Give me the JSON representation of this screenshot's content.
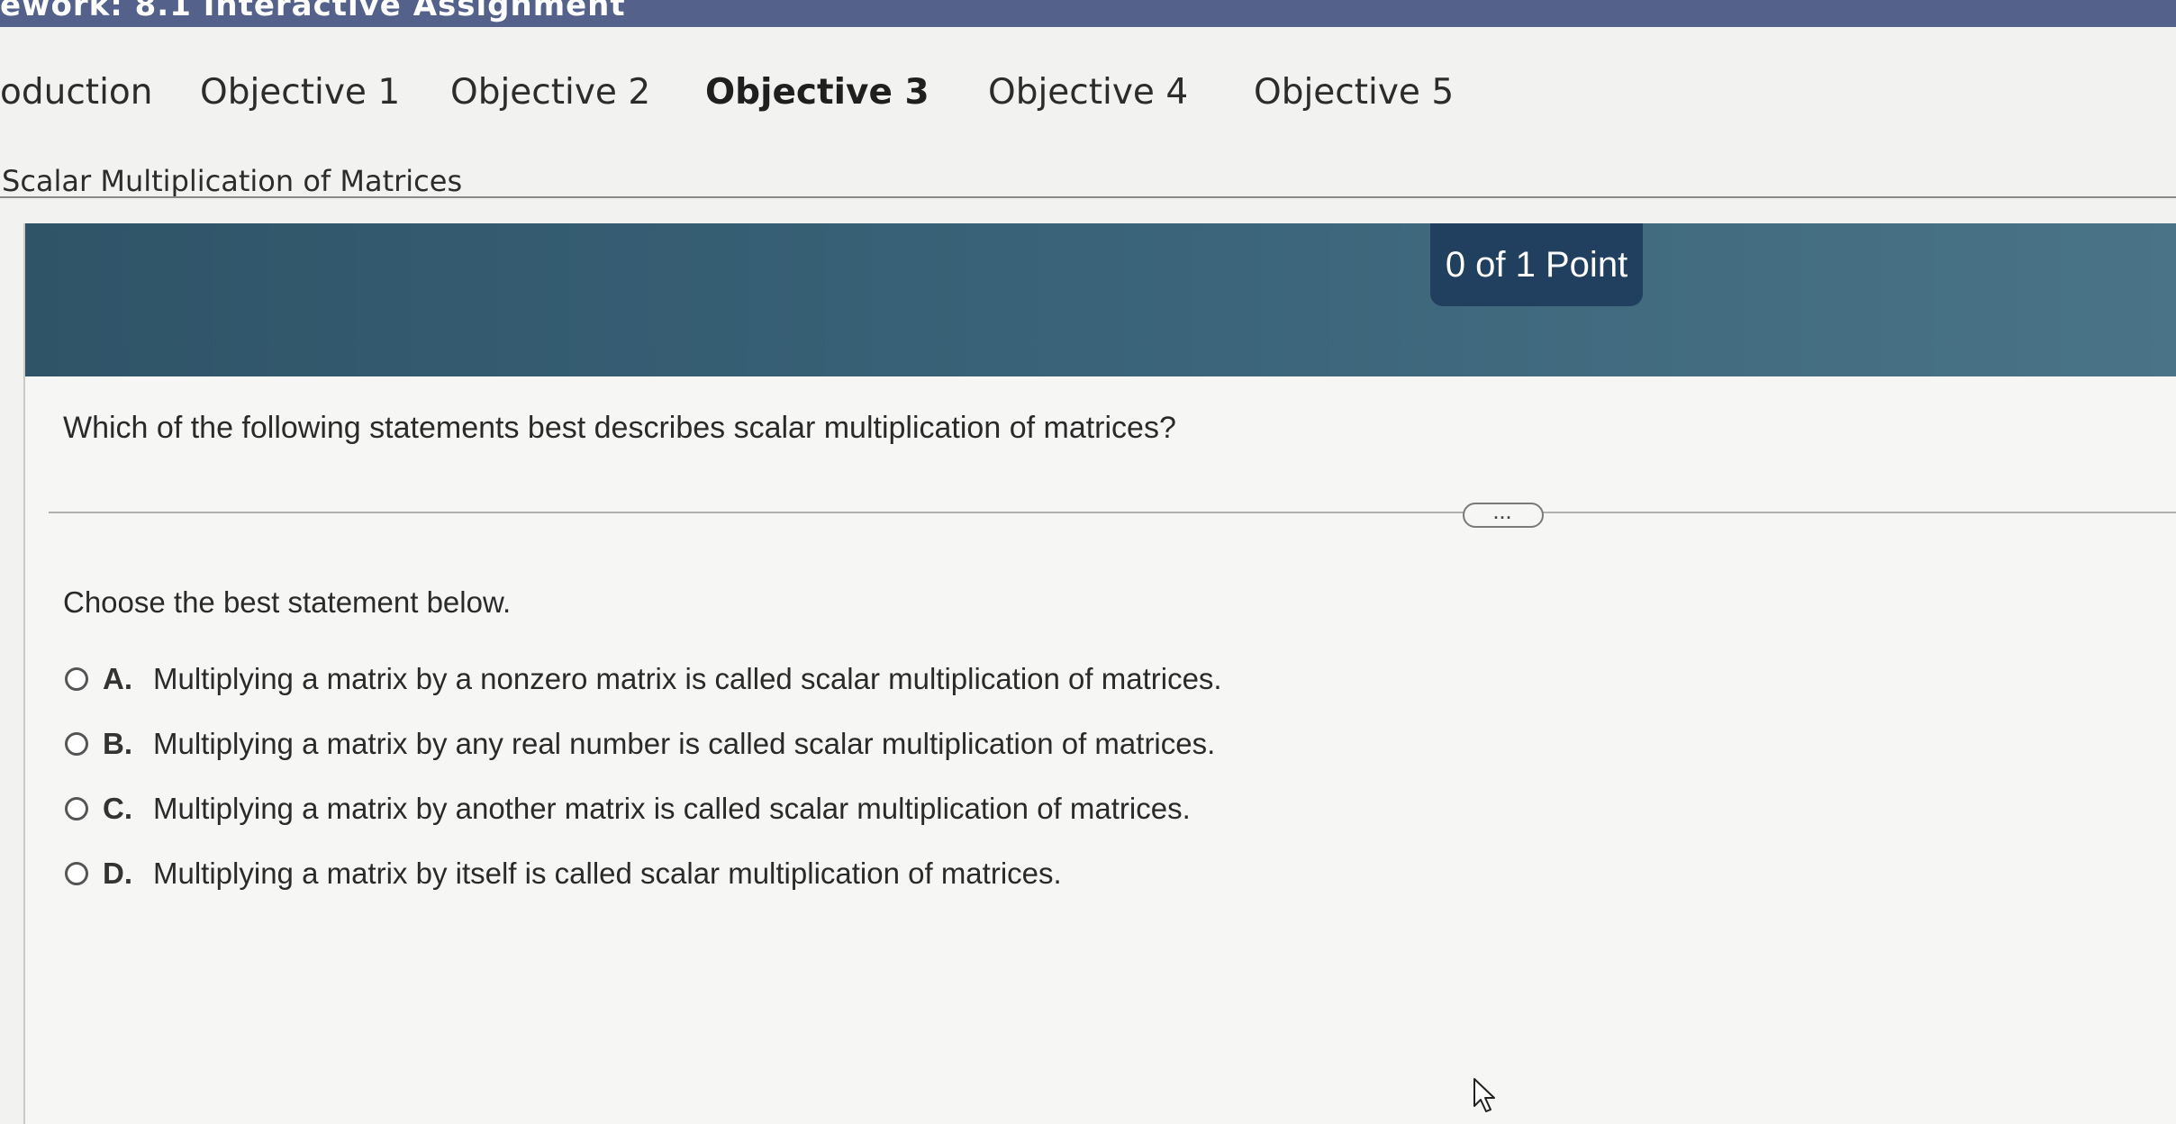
{
  "window": {
    "title": "ework: 8.1 Interactive Assignment"
  },
  "tabs": [
    {
      "label": "oduction",
      "active": false
    },
    {
      "label": "Objective 1",
      "active": false
    },
    {
      "label": "Objective 2",
      "active": false
    },
    {
      "label": "Objective 3",
      "active": true
    },
    {
      "label": "Objective 4",
      "active": false
    },
    {
      "label": "Objective 5",
      "active": false
    }
  ],
  "section": {
    "title": "Scalar Multiplication of Matrices"
  },
  "score": {
    "label": "0 of 1 Point"
  },
  "question": {
    "text": "Which of the following statements best describes scalar multiplication of matrices?",
    "more_label": "...",
    "prompt": "Choose the best statement below."
  },
  "options": [
    {
      "letter": "A.",
      "text": "Multiplying a matrix by a nonzero matrix is called scalar multiplication of matrices."
    },
    {
      "letter": "B.",
      "text": "Multiplying a matrix by any real number is called scalar multiplication of matrices."
    },
    {
      "letter": "C.",
      "text": "Multiplying a matrix by another matrix is called scalar multiplication of matrices."
    },
    {
      "letter": "D.",
      "text": "Multiplying a matrix by itself is called scalar multiplication of matrices."
    }
  ],
  "icons": {
    "radio": "radio-unselected-icon",
    "cursor": "mouse-pointer-icon"
  },
  "colors": {
    "banner": "#3a6379",
    "badge": "#213f5e",
    "topbar": "#54618a"
  }
}
